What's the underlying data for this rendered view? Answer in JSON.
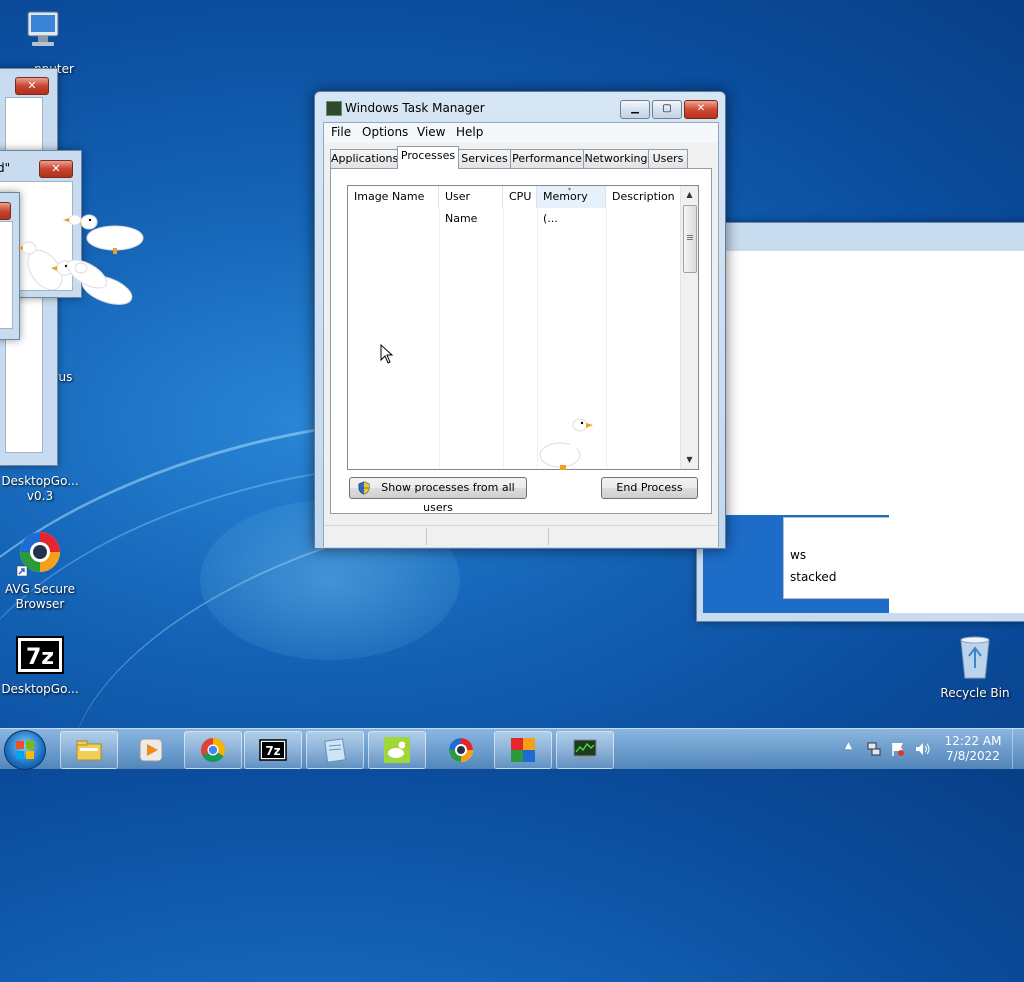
{
  "desktop": {
    "icons": [
      {
        "label": "Computer",
        "visible_label": "nputer"
      },
      {
        "label": "rus"
      },
      {
        "label_line1": "DesktopGo...",
        "label_line2": "v0.3"
      },
      {
        "label_line1": "AVG Secure",
        "label_line2": "Browser"
      },
      {
        "label": "DesktopGo..."
      },
      {
        "label": "Recycle Bin"
      }
    ]
  },
  "bg_windows": {
    "fragment_title": "d\"",
    "list_text_1": "ws",
    "list_text_2": "stacked"
  },
  "task_manager": {
    "title": "Windows Task Manager",
    "menu": [
      "File",
      "Options",
      "View",
      "Help"
    ],
    "tabs": [
      "Applications",
      "Processes",
      "Services",
      "Performance",
      "Networking",
      "Users"
    ],
    "active_tab": "Processes",
    "columns": [
      "Image Name",
      "User Name",
      "CPU",
      "Memory (...",
      "Description"
    ],
    "sorted_column": "Memory (...",
    "show_all_label": "Show processes from all users",
    "end_process_label": "End Process"
  },
  "taskbar": {
    "pinned": [
      "windows-explorer",
      "windows-media-player",
      "chrome",
      "7-zip",
      "notepad",
      "desktop-goose",
      "avg-secure-browser",
      "avg-antivirus",
      "task-manager"
    ],
    "clock_time": "12:22 AM",
    "clock_date": "7/8/2022"
  },
  "colors": {
    "desktop_blue": "#1565b8",
    "close_red": "#c8452f",
    "window_frame": "#c3d8ee"
  }
}
